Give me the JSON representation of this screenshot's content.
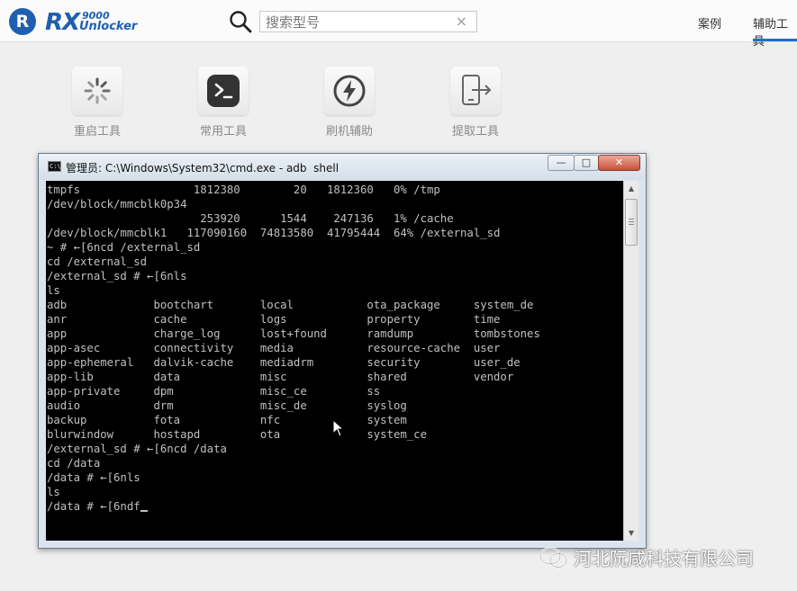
{
  "app": {
    "logo_letter": "R",
    "logo_rx": "RX",
    "logo_9000": "9000",
    "logo_unlocker": "Unlocker"
  },
  "search": {
    "placeholder": "搜索型号",
    "clear_glyph": "×",
    "icon": "search-icon"
  },
  "nav": {
    "items": [
      {
        "label": "案例",
        "active": false
      },
      {
        "label": "辅助工具",
        "active": true
      }
    ],
    "accent_color": "#1a73c9"
  },
  "tools": [
    {
      "label": "重启工具",
      "icon": "loading-spinner-icon"
    },
    {
      "label": "常用工具",
      "icon": "terminal-icon"
    },
    {
      "label": "刷机辅助",
      "icon": "lightning-icon"
    },
    {
      "label": "提取工具",
      "icon": "phone-export-icon"
    }
  ],
  "cmd_window": {
    "title": "管理员: C:\\Windows\\System32\\cmd.exe - adb  shell",
    "buttons": {
      "minimize": "—",
      "maximize": "□",
      "close": "✕"
    },
    "console_lines": [
      "tmpfs                 1812380        20   1812360   0% /tmp",
      "/dev/block/mmcblk0p34",
      "                       253920      1544    247136   1% /cache",
      "/dev/block/mmcblk1   117090160  74813580  41795444  64% /external_sd",
      "~ # ←[6ncd /external_sd",
      "cd /external_sd",
      "/external_sd # ←[6nls",
      "ls",
      "adb             bootchart       local           ota_package     system_de",
      "anr             cache           logs            property        time",
      "app             charge_log      lost+found      ramdump         tombstones",
      "app-asec        connectivity    media           resource-cache  user",
      "app-ephemeral   dalvik-cache    mediadrm        security        user_de",
      "app-lib         data            misc            shared          vendor",
      "app-private     dpm             misc_ce         ss",
      "audio           drm             misc_de         syslog",
      "backup          fota            nfc             system",
      "blurwindow      hostapd         ota             system_ce",
      "/external_sd # ←[6ncd /data",
      "cd /data",
      "/data # ←[6nls",
      "ls",
      "/data # ←[6ndf"
    ]
  },
  "watermark": {
    "text": "河北阮咸科技有限公司",
    "icon": "wechat-icon"
  }
}
